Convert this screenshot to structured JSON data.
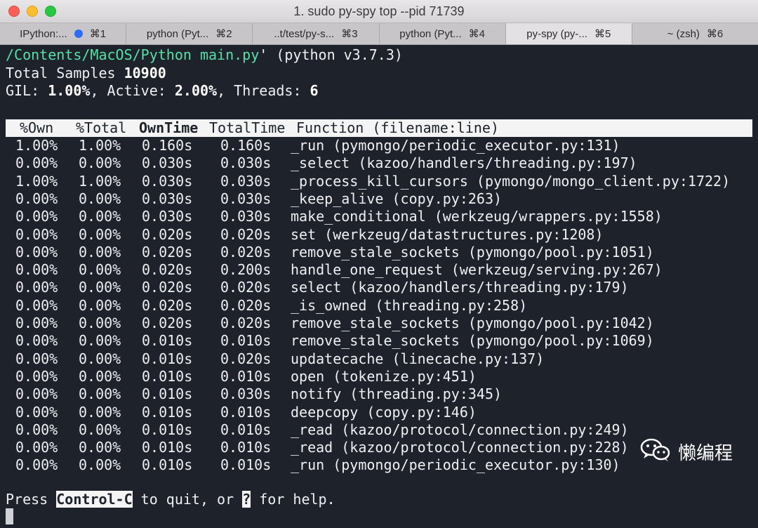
{
  "window": {
    "title": "1. sudo py-spy top --pid 71739"
  },
  "tabs": [
    {
      "label": "IPython:...",
      "shortcut": "⌘1",
      "has_dot": true,
      "active": false
    },
    {
      "label": "python (Pyt...",
      "shortcut": "⌘2",
      "active": false
    },
    {
      "label": "..t/test/py-s...",
      "shortcut": "⌘3",
      "active": false
    },
    {
      "label": "python (Pyt...",
      "shortcut": "⌘4",
      "active": false
    },
    {
      "label": "py-spy (py-...",
      "shortcut": "⌘5",
      "active": true
    },
    {
      "label": "~ (zsh)",
      "shortcut": "⌘6",
      "active": false
    }
  ],
  "terminal": {
    "path_text": "/Contents/MacOS/Python main.py",
    "version_text": "' (python v3.7.3)",
    "samples_label": "Total Samples ",
    "samples_value": "10900",
    "gil_label": "GIL: ",
    "gil_value": "1.00%",
    "active_label": ", Active: ",
    "active_value": "2.00%",
    "threads_label": ", Threads: ",
    "threads_value": "6",
    "columns": {
      "own": "%Own",
      "total": "%Total",
      "own_time": "OwnTime",
      "total_time": "TotalTime",
      "function": "Function (filename:line)"
    },
    "rows": [
      {
        "own": "1.00%",
        "total": "1.00%",
        "own_time": "0.160s",
        "total_time": "0.160s",
        "function": "_run (pymongo/periodic_executor.py:131)"
      },
      {
        "own": "0.00%",
        "total": "0.00%",
        "own_time": "0.030s",
        "total_time": "0.030s",
        "function": "_select (kazoo/handlers/threading.py:197)"
      },
      {
        "own": "1.00%",
        "total": "1.00%",
        "own_time": "0.030s",
        "total_time": "0.030s",
        "function": "_process_kill_cursors (pymongo/mongo_client.py:1722)"
      },
      {
        "own": "0.00%",
        "total": "0.00%",
        "own_time": "0.030s",
        "total_time": "0.030s",
        "function": "_keep_alive (copy.py:263)"
      },
      {
        "own": "0.00%",
        "total": "0.00%",
        "own_time": "0.030s",
        "total_time": "0.030s",
        "function": "make_conditional (werkzeug/wrappers.py:1558)"
      },
      {
        "own": "0.00%",
        "total": "0.00%",
        "own_time": "0.020s",
        "total_time": "0.020s",
        "function": "set (werkzeug/datastructures.py:1208)"
      },
      {
        "own": "0.00%",
        "total": "0.00%",
        "own_time": "0.020s",
        "total_time": "0.020s",
        "function": "remove_stale_sockets (pymongo/pool.py:1051)"
      },
      {
        "own": "0.00%",
        "total": "0.00%",
        "own_time": "0.020s",
        "total_time": "0.200s",
        "function": "handle_one_request (werkzeug/serving.py:267)"
      },
      {
        "own": "0.00%",
        "total": "0.00%",
        "own_time": "0.020s",
        "total_time": "0.020s",
        "function": "select (kazoo/handlers/threading.py:179)"
      },
      {
        "own": "0.00%",
        "total": "0.00%",
        "own_time": "0.020s",
        "total_time": "0.020s",
        "function": "_is_owned (threading.py:258)"
      },
      {
        "own": "0.00%",
        "total": "0.00%",
        "own_time": "0.020s",
        "total_time": "0.020s",
        "function": "remove_stale_sockets (pymongo/pool.py:1042)"
      },
      {
        "own": "0.00%",
        "total": "0.00%",
        "own_time": "0.010s",
        "total_time": "0.010s",
        "function": "remove_stale_sockets (pymongo/pool.py:1069)"
      },
      {
        "own": "0.00%",
        "total": "0.00%",
        "own_time": "0.010s",
        "total_time": "0.020s",
        "function": "updatecache (linecache.py:137)"
      },
      {
        "own": "0.00%",
        "total": "0.00%",
        "own_time": "0.010s",
        "total_time": "0.010s",
        "function": "open (tokenize.py:451)"
      },
      {
        "own": "0.00%",
        "total": "0.00%",
        "own_time": "0.010s",
        "total_time": "0.030s",
        "function": "notify (threading.py:345)"
      },
      {
        "own": "0.00%",
        "total": "0.00%",
        "own_time": "0.010s",
        "total_time": "0.010s",
        "function": "deepcopy (copy.py:146)"
      },
      {
        "own": "0.00%",
        "total": "0.00%",
        "own_time": "0.010s",
        "total_time": "0.010s",
        "function": "_read (kazoo/protocol/connection.py:249)"
      },
      {
        "own": "0.00%",
        "total": "0.00%",
        "own_time": "0.010s",
        "total_time": "0.010s",
        "function": "_read (kazoo/protocol/connection.py:228)"
      },
      {
        "own": "0.00%",
        "total": "0.00%",
        "own_time": "0.010s",
        "total_time": "0.010s",
        "function": "_run (pymongo/periodic_executor.py:130)"
      }
    ],
    "footer": {
      "press": "Press ",
      "key_quit": "Control-C",
      "to_quit": " to quit, or ",
      "key_help": "?",
      "for_help": " for help."
    }
  },
  "watermark": {
    "text": "懒编程",
    "icon": "wechat-icon"
  },
  "colors": {
    "terminal_bg": "#1d222b",
    "path_green": "#54e0a6",
    "header_bg": "#f4f4f4"
  }
}
